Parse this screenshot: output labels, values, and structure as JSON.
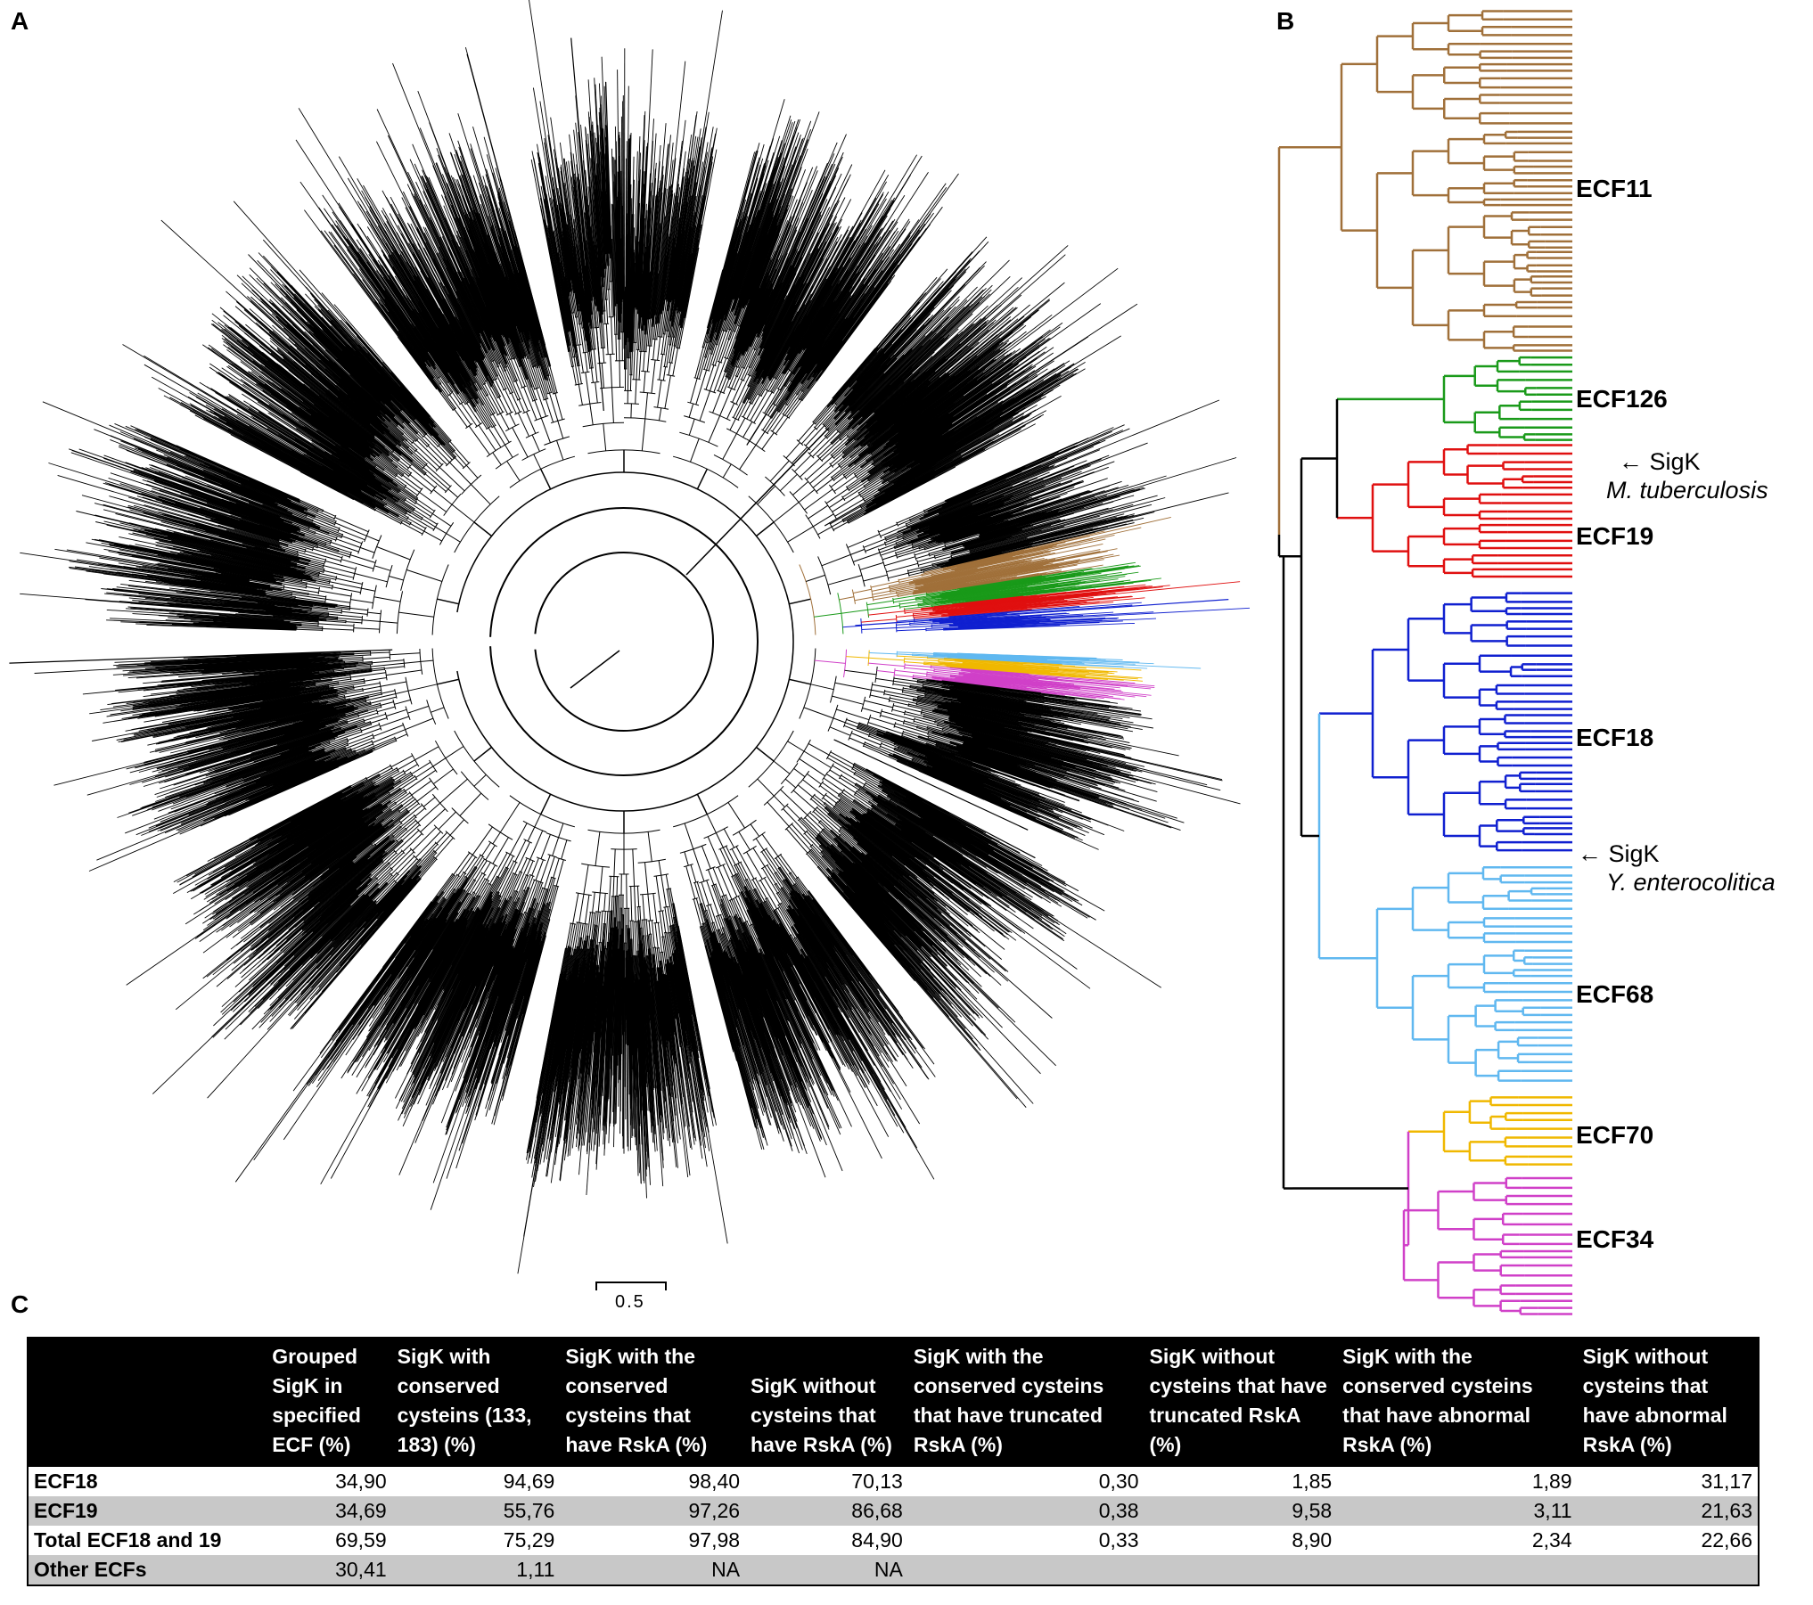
{
  "panels": {
    "a": "A",
    "b": "B",
    "c": "C"
  },
  "scale_bar": {
    "label": "0.5"
  },
  "clade_colors": {
    "ECF11": "#a0703a",
    "ECF126": "#1a9a1a",
    "ECF19": "#e01010",
    "ECF18": "#1020d0",
    "ECF68": "#60b8f0",
    "ECF70": "#f0b800",
    "ECF34": "#d040c8"
  },
  "tree_b": {
    "clades": [
      {
        "name": "ECF11",
        "color": "#a0703a"
      },
      {
        "name": "ECF126",
        "color": "#1a9a1a"
      },
      {
        "name": "ECF19",
        "color": "#e01010"
      },
      {
        "name": "ECF18",
        "color": "#1020d0"
      },
      {
        "name": "ECF68",
        "color": "#60b8f0"
      },
      {
        "name": "ECF70",
        "color": "#f0b800"
      },
      {
        "name": "ECF34",
        "color": "#d040c8"
      }
    ],
    "annotations": [
      {
        "label": "SigK",
        "species": "M. tuberculosis"
      },
      {
        "label": "SigK",
        "species": "Y. enterocolitica"
      }
    ]
  },
  "table": {
    "headers": [
      "",
      "Grouped SigK in specified ECF (%)",
      "SigK with conserved cysteins (133, 183) (%)",
      "SigK with the conserved cysteins that have RskA (%)",
      "SigK without cysteins that have RskA (%)",
      "SigK with the conserved cysteins that have truncated RskA (%)",
      "SigK without cysteins that have truncated RskA (%)",
      " SigK with the conserved cysteins that have abnormal RskA (%)",
      "SigK without cysteins that have abnormal RskA (%)"
    ],
    "rows": [
      [
        "ECF18",
        "34,90",
        "94,69",
        "98,40",
        "70,13",
        "0,30",
        "1,85",
        "1,89",
        "31,17"
      ],
      [
        "ECF19",
        "34,69",
        "55,76",
        "97,26",
        "86,68",
        "0,38",
        "9,58",
        "3,11",
        "21,63"
      ],
      [
        "Total ECF18 and 19",
        "69,59",
        "75,29",
        "97,98",
        "84,90",
        "0,33",
        "8,90",
        "2,34",
        "22,66"
      ],
      [
        "Other ECFs",
        "30,41",
        "1,11",
        "NA",
        "NA",
        "",
        "",
        "",
        ""
      ]
    ]
  }
}
